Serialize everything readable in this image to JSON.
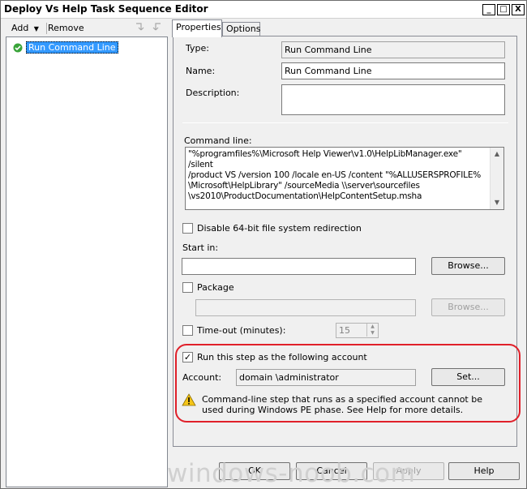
{
  "window": {
    "title": "Deploy Vs Help Task Sequence Editor",
    "min_glyph": "_",
    "max_glyph": "□",
    "close_glyph": "X"
  },
  "toolbar": {
    "add_label": "Add",
    "remove_label": "Remove"
  },
  "tree": {
    "items": [
      {
        "label": "Run Command Line",
        "icon": "green-check-icon"
      }
    ]
  },
  "tabs": [
    {
      "label": "Properties",
      "active": true
    },
    {
      "label": "Options",
      "active": false
    }
  ],
  "properties": {
    "type_label": "Type:",
    "type_value": "Run Command Line",
    "name_label": "Name:",
    "name_value": "Run Command Line",
    "description_label": "Description:",
    "description_value": "",
    "command_line_label": "Command line:",
    "command_line_value": "\"%programfiles%\\Microsoft Help Viewer\\v1.0\\HelpLibManager.exe\" /silent\n/product VS /version 100 /locale en-US /content \"%ALLUSERSPROFILE%\n\\Microsoft\\HelpLibrary\" /sourceMedia \\\\server\\sourcefiles\n\\vs2010\\ProductDocumentation\\HelpContentSetup.msha",
    "disable_redirect_label": "Disable 64-bit file system redirection",
    "disable_redirect_checked": false,
    "start_in_label": "Start in:",
    "start_in_value": "",
    "browse_label": "Browse...",
    "package_label": "Package",
    "package_checked": false,
    "package_value": "",
    "package_browse_label": "Browse...",
    "timeout_label": "Time-out (minutes):",
    "timeout_checked": false,
    "timeout_value": "15",
    "run_as_label": "Run this step as the following account",
    "run_as_checked": true,
    "account_label": "Account:",
    "account_value": "domain \\administrator",
    "set_label": "Set...",
    "warning_text": "Command-line step that runs as a specified account cannot be used during Windows PE phase. See Help for more details."
  },
  "footer": {
    "ok_label": "OK",
    "cancel_label": "Cancel",
    "apply_label": "Apply",
    "help_label": "Help"
  },
  "watermark": "windows-noob.com",
  "colors": {
    "highlight": "#3399ff",
    "annotation_red": "#e0202a",
    "warning_yellow": "#f5c518"
  }
}
